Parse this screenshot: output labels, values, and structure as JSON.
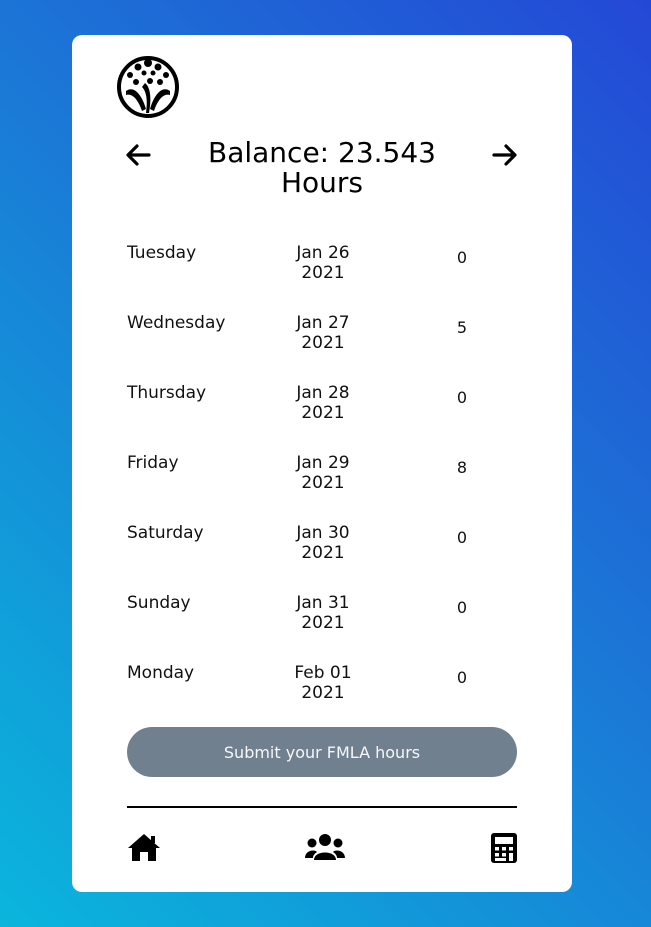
{
  "balance": {
    "text": "Balance: 23.543 Hours"
  },
  "nav": {
    "prev_icon": "arrow-left-icon",
    "next_icon": "arrow-right-icon"
  },
  "days": [
    {
      "day": "Tuesday",
      "date": "Jan 26 2021",
      "hours": "0"
    },
    {
      "day": "Wednesday",
      "date": "Jan 27 2021",
      "hours": "5"
    },
    {
      "day": "Thursday",
      "date": "Jan 28 2021",
      "hours": "0"
    },
    {
      "day": "Friday",
      "date": "Jan 29 2021",
      "hours": "8"
    },
    {
      "day": "Saturday",
      "date": "Jan 30 2021",
      "hours": "0"
    },
    {
      "day": "Sunday",
      "date": "Jan 31 2021",
      "hours": "0"
    },
    {
      "day": "Monday",
      "date": "Feb 01 2021",
      "hours": "0"
    }
  ],
  "submit": {
    "label": "Submit your FMLA hours"
  },
  "tabbar": {
    "items": [
      "home-icon",
      "users-icon",
      "calculator-icon"
    ]
  },
  "colors": {
    "button": "#71808f",
    "background_start": "#2448d6",
    "background_end": "#0ab6dc"
  }
}
